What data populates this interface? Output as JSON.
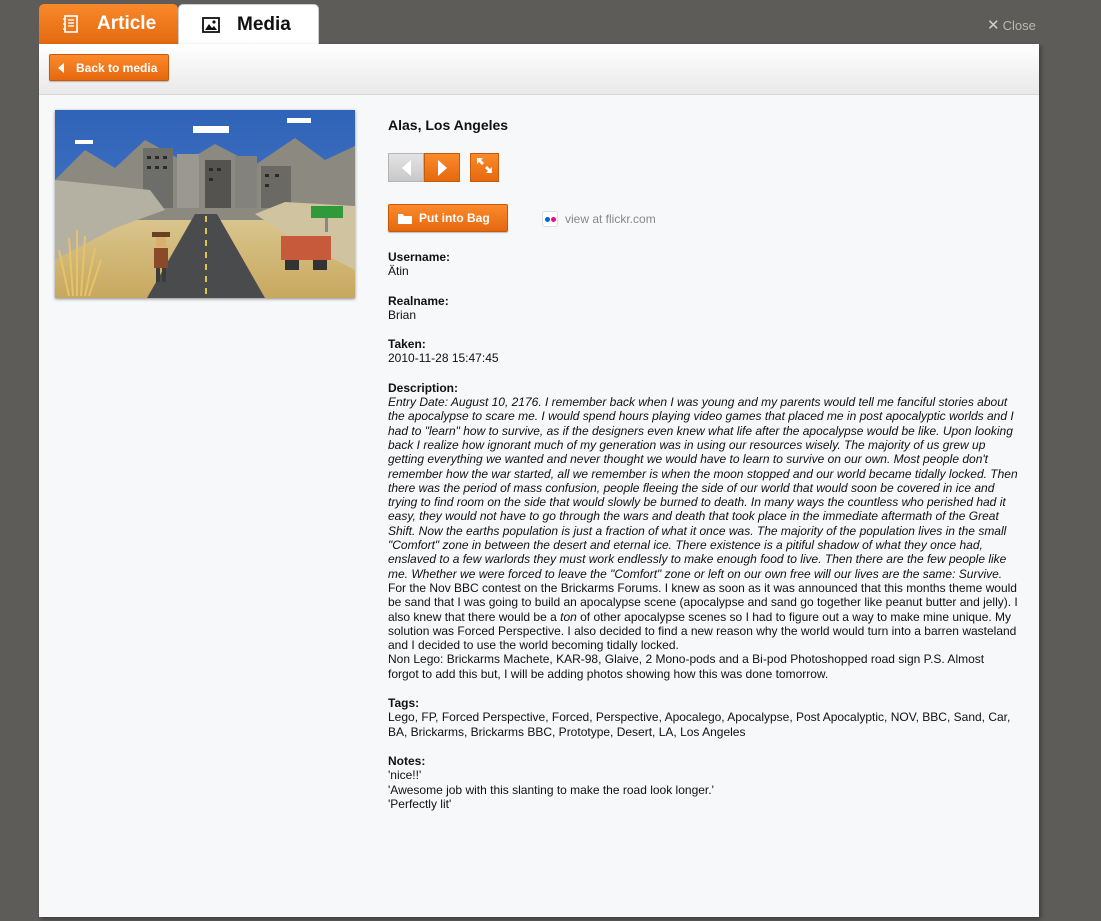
{
  "tabs": {
    "article_label": "Article",
    "media_label": "Media",
    "close_label": "Close"
  },
  "toolbar": {
    "back_label": "Back to media"
  },
  "photo": {
    "title": "Alas, Los Angeles",
    "bag_label": "Put into Bag",
    "flickr_label": "view at flickr.com"
  },
  "fields": {
    "username_label": "Username:",
    "username": "Ätin",
    "realname_label": "Realname:",
    "realname": "Brian",
    "taken_label": "Taken:",
    "taken": "2010-11-28 15:47:45",
    "description_label": "Description:",
    "description_italic": " Entry Date: August 10, 2176. I remember back when I was young and my parents would tell me fanciful stories about the apocalypse to scare me. I would spend hours playing video games that placed me in post apocalyptic worlds and I had to \"learn\" how to survive, as if the designers even knew what life after the apocalypse would be like. Upon looking back I realize how ignorant much of my generation was in using our resources wisely. The majority of us grew up getting everything we wanted and never thought we would have to learn to survive on our own. Most people don't remember how the war started, all we remember is when the moon stopped and our world became tidally locked. Then there was the period of mass confusion, people fleeing the side of our world that would soon be covered in ice and trying to find room on the side that would slowly be burned to death. In many ways the countless who perished had it easy, they would not have to go through the wars and death that took place in the immediate aftermath of the Great Shift. Now the earths population is just a fraction of what it once was. The majority of the population lives in the small \"Comfort\" zone in between the desert and eternal ice. There existence is a pitiful shadow of what they once had, enslaved to a few warlords they must work endlessly to make enough food to live. Then there are the few people like me. Whether we were forced to leave the \"Comfort\" zone or left on our own free will our lives are the same: Survive.",
    "description_part2": " For the Nov BBC contest on the Brickarms Forums. I knew as soon as it was announced that this months theme would be sand that I was going to build an apocalypse scene (apocalypse and sand go together like peanut butter and jelly). I also knew that there would be a ",
    "description_ton": "ton",
    "description_part3": " of other apocalypse scenes so I had to figure out a way to make mine unique. My solution was Forced Perspective. I also decided to find a new reason why the world would turn into a barren wasteland and I decided to use the world becoming tidally locked.",
    "description_part4": "Non Lego: Brickarms Machete, KAR-98, Glaive, 2 Mono-pods and a Bi-pod Photoshopped road sign P.S. Almost forgot to add this but, I will be adding photos showing how this was done tomorrow.",
    "tags_label": "Tags:",
    "tags": "Lego, FP, Forced Perspective, Forced, Perspective, Apocalego, Apocalypse, Post Apocalyptic, NOV, BBC, Sand, Car, BA, Brickarms, Brickarms BBC, Prototype, Desert, LA, Los Angeles",
    "notes_label": "Notes:",
    "notes": [
      "'nice!!'",
      "'Awesome job with this slanting to make the road look longer.'",
      "'Perfectly lit'"
    ]
  },
  "colors": {
    "accent": "#f07a1c",
    "background": "#5d5c58",
    "panel": "#f6f8fa"
  }
}
